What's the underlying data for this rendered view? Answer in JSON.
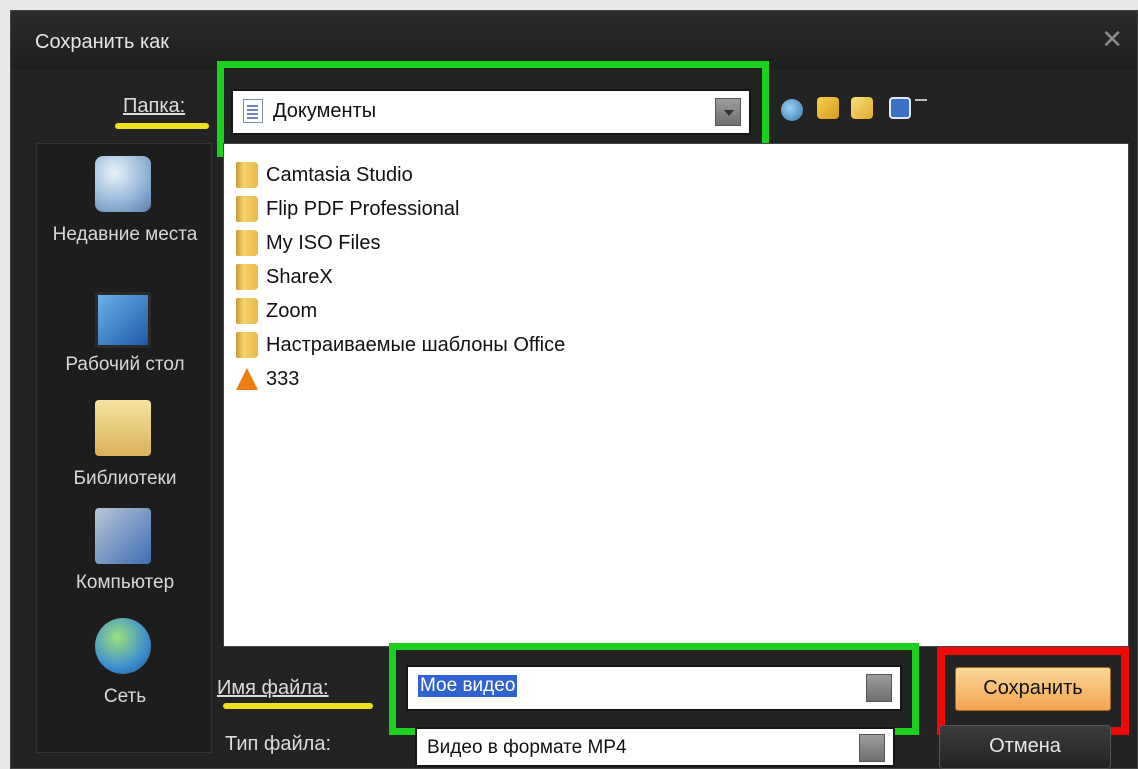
{
  "window": {
    "title": "Сохранить как"
  },
  "location": {
    "label": "Папка:",
    "value": "Документы"
  },
  "toolbar": {
    "icons": [
      "back-icon",
      "up-folder-icon",
      "new-folder-icon",
      "view-menu-icon"
    ]
  },
  "sidebar": {
    "items": [
      {
        "label": "Недавние места",
        "icon": "recent-places-icon"
      },
      {
        "label": "Рабочий стол",
        "icon": "desktop-icon"
      },
      {
        "label": "Библиотеки",
        "icon": "libraries-icon"
      },
      {
        "label": "Компьютер",
        "icon": "computer-icon"
      },
      {
        "label": "Сеть",
        "icon": "network-icon"
      }
    ]
  },
  "files": [
    {
      "name": "Camtasia Studio",
      "type": "folder"
    },
    {
      "name": "Flip PDF Professional",
      "type": "folder"
    },
    {
      "name": "My ISO Files",
      "type": "folder"
    },
    {
      "name": "ShareX",
      "type": "folder"
    },
    {
      "name": "Zoom",
      "type": "folder"
    },
    {
      "name": "Настраиваемые шаблоны Office",
      "type": "folder"
    },
    {
      "name": "333",
      "type": "vlc-file"
    }
  ],
  "filename": {
    "label": "Имя файла:",
    "value": "Мое видео"
  },
  "filetype": {
    "label": "Тип файла:",
    "value": "Видео в формате MP4"
  },
  "buttons": {
    "save": "Сохранить",
    "cancel": "Отмена"
  },
  "colors": {
    "highlight_green": "#1ed01e",
    "highlight_red": "#ef0a0a",
    "underline_yellow": "#f0e020"
  }
}
